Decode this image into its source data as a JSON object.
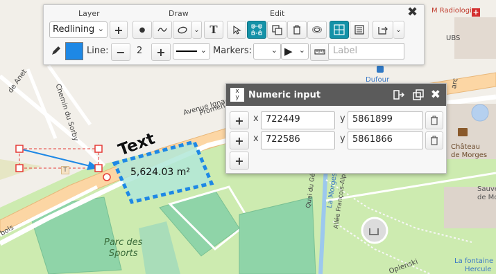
{
  "map": {
    "labels": {
      "promenade_short": "Prom",
      "promenade_right": "Promen",
      "avenue": "Avenue Ignace Paderewski",
      "chemin_sorby": "Chemin du Sorby",
      "ande_anet": "de Anet",
      "parc_des_sports_1": "Parc des",
      "parc_des_sports_2": "Sports",
      "general_guisan": "Quai du Général-Guisan",
      "allee_alphonse": "Allée François-Alphonse",
      "la_morges": "La Morges",
      "opienski": "Opienski",
      "chateau_1": "Château",
      "chateau_2": "de Morges",
      "sauve_1": "Sauve",
      "sauve_2": "de Mo",
      "fontaine_1": "La fontaine d'",
      "fontaine_2": "Hercule",
      "radiologie": "M Radiologie",
      "ubs": "UBS",
      "dufour": "Dufour",
      "bols": "bols",
      "parc_right": "arc"
    },
    "drawing": {
      "text_annotation": "Text",
      "area_label": "5,624.03 m²",
      "arrow_marker": "T"
    }
  },
  "toolbar": {
    "layer_title": "Layer",
    "draw_title": "Draw",
    "edit_title": "Edit",
    "layer_select_value": "Redlining",
    "line_label": "Line:",
    "line_width_value": "2",
    "markers_label": "Markers:",
    "label_placeholder": "Label",
    "color_swatch": "#1e88e5"
  },
  "numeric_input": {
    "title": "Numeric input",
    "x_label": "x",
    "y_label": "y",
    "rows": [
      {
        "x": "722449",
        "y": "5861899"
      },
      {
        "x": "722586",
        "y": "5861866"
      }
    ]
  },
  "colors": {
    "accent": "#1592a8",
    "dialog_title_bg": "#5b5b5b",
    "drawing_blue": "#1e88e5",
    "area_fill": "#b2e8d8",
    "selection_red": "#e53935"
  }
}
